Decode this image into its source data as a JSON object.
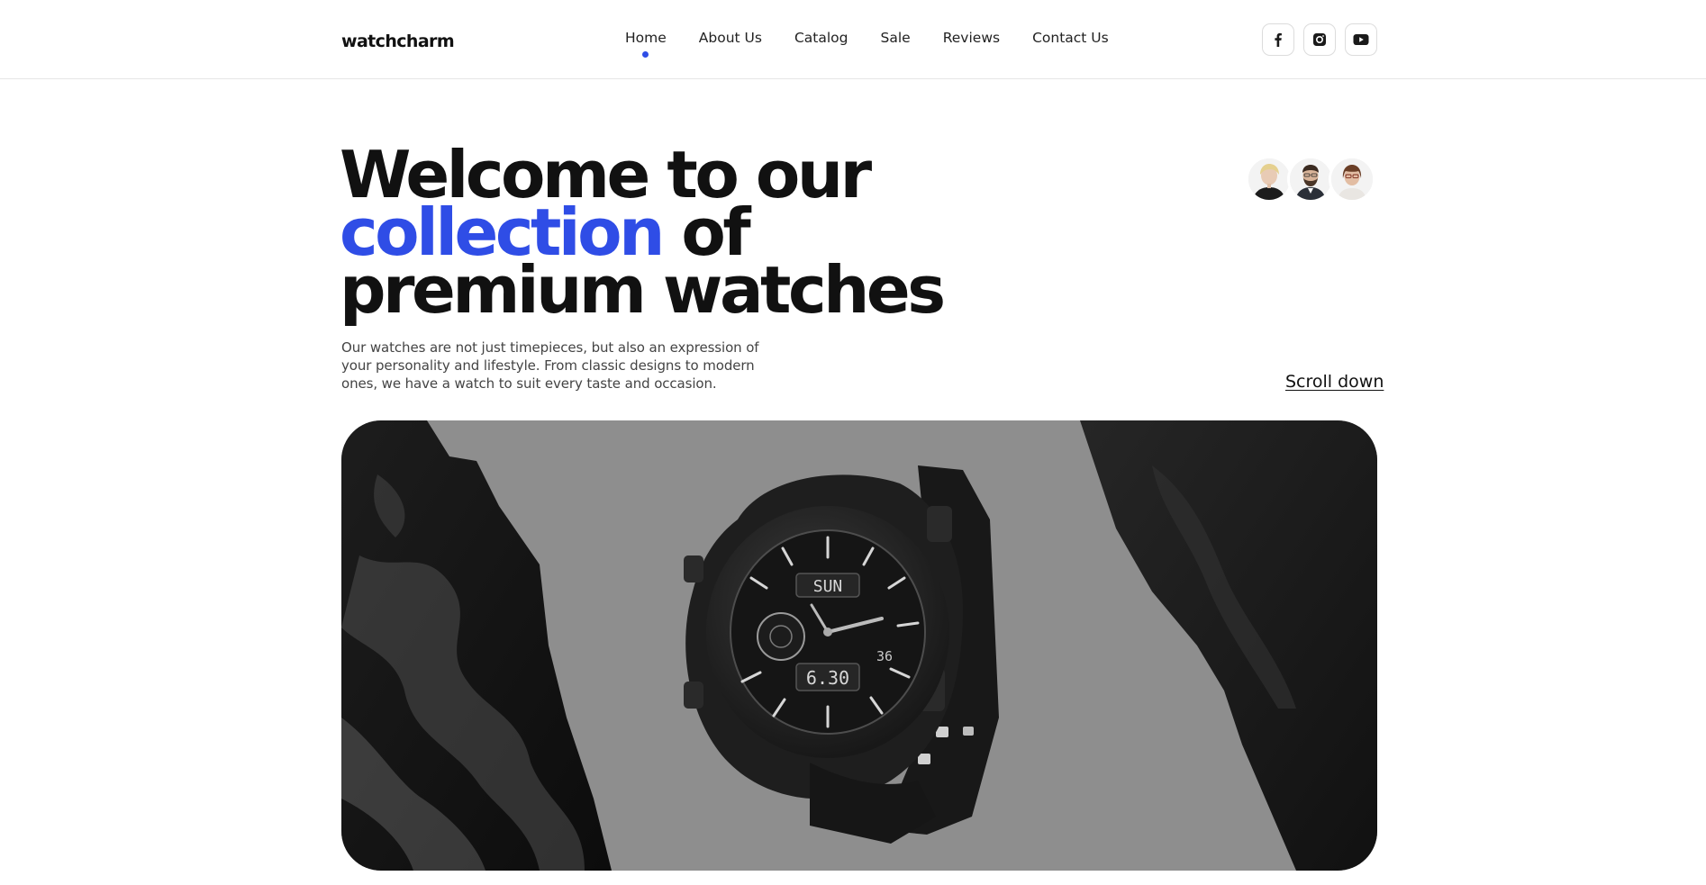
{
  "header": {
    "logo": "watchcharm",
    "nav": [
      {
        "label": "Home",
        "active": true
      },
      {
        "label": "About Us",
        "active": false
      },
      {
        "label": "Catalog",
        "active": false
      },
      {
        "label": "Sale",
        "active": false
      },
      {
        "label": "Reviews",
        "active": false
      },
      {
        "label": "Contact Us",
        "active": false
      }
    ],
    "socials": [
      {
        "icon": "facebook-icon"
      },
      {
        "icon": "instagram-icon"
      },
      {
        "icon": "youtube-icon"
      }
    ]
  },
  "hero": {
    "title_line1": "Welcome to our",
    "title_accent": "collection",
    "title_line2_rest": " of",
    "title_line3": "premium watches",
    "description": "Our watches are not just timepieces, but also an expression of your personality and lifestyle. From classic designs to modern ones, we have a watch to suit every taste and occasion.",
    "scroll_label": "Scroll down",
    "watch_display": {
      "day": "SUN",
      "small": "36",
      "time": "6.30"
    }
  },
  "colors": {
    "accent": "#2f4de6",
    "text": "#111111",
    "image_bg": "#8e8e8e"
  }
}
